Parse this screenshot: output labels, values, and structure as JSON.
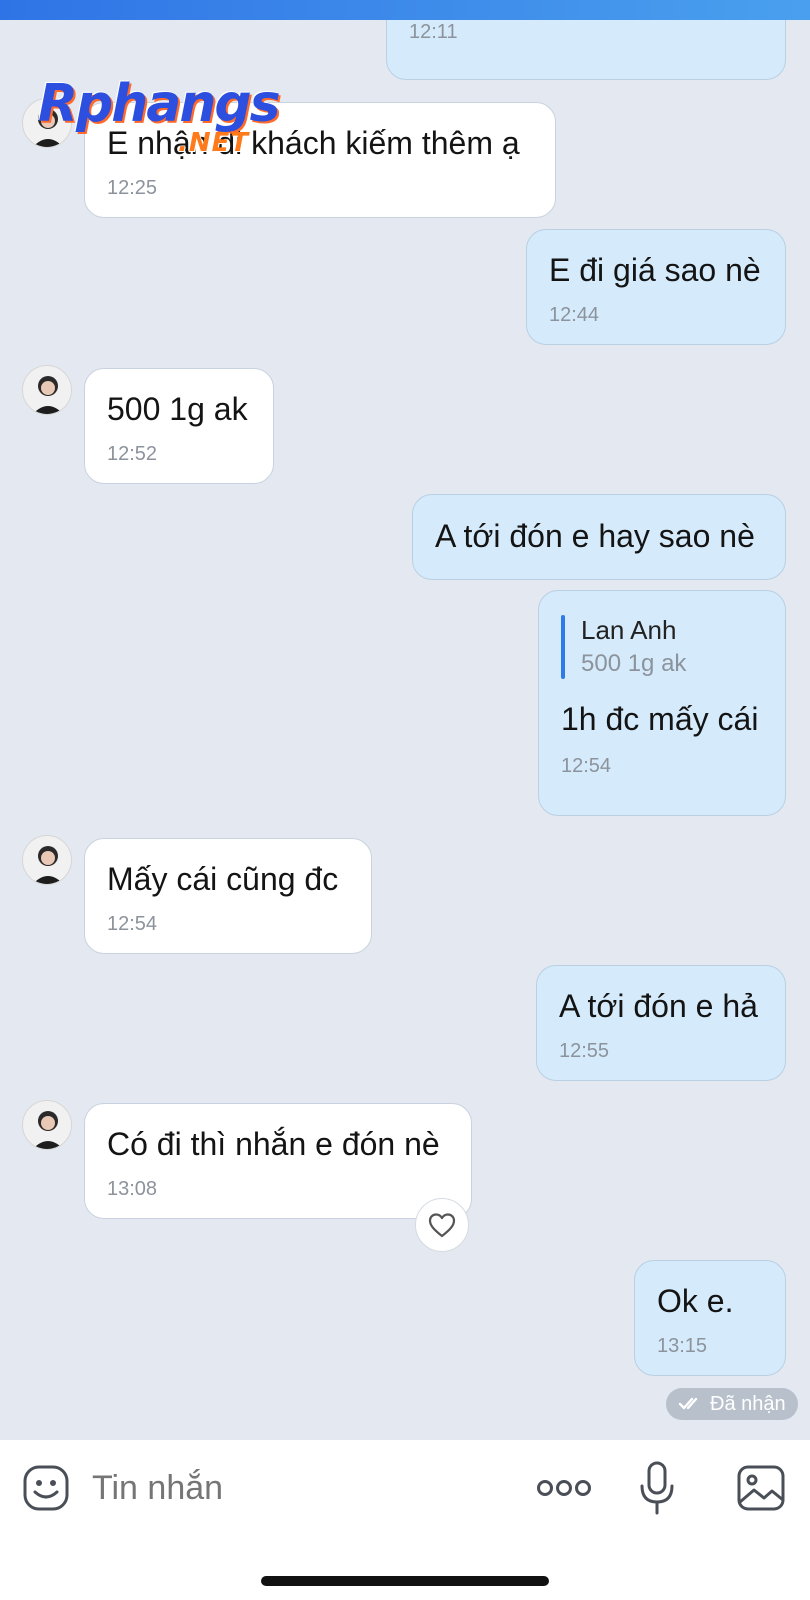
{
  "chat": {
    "messages": [
      {
        "dir": "out",
        "text": "",
        "time": "12:11"
      },
      {
        "dir": "in",
        "text": "E nhận đi khách kiếm thêm ạ",
        "time": "12:25"
      },
      {
        "dir": "out",
        "text": "E đi giá sao nè",
        "time": "12:44"
      },
      {
        "dir": "in",
        "text": "500 1g ak",
        "time": "12:52"
      },
      {
        "dir": "out",
        "text": "A tới đón e hay sao nè",
        "time": ""
      },
      {
        "dir": "out",
        "quote_author": "Lan Anh",
        "quote_text": "500 1g ak",
        "text": "1h đc mấy cái",
        "time": "12:54"
      },
      {
        "dir": "in",
        "text": "Mấy cái cũng đc",
        "time": "12:54"
      },
      {
        "dir": "out",
        "text": "A tới đón e hả",
        "time": "12:55"
      },
      {
        "dir": "in",
        "text": "Có đi thì nhắn e đón nè",
        "time": "13:08"
      },
      {
        "dir": "out",
        "text": "Ok e.",
        "time": "13:15"
      }
    ],
    "status": "Đã nhận",
    "react_icon": "heart-icon"
  },
  "watermark": {
    "main": "Rphangs",
    "suffix": ".NET"
  },
  "input": {
    "placeholder": "Tin nhắn"
  },
  "icons": [
    "emoji-icon",
    "more-icon",
    "microphone-icon",
    "gallery-icon"
  ],
  "colors": {
    "accent": "#2e7be8",
    "out_bubble": "#d5ebfb",
    "in_bubble": "#ffffff",
    "background": "#e3e8f1"
  }
}
